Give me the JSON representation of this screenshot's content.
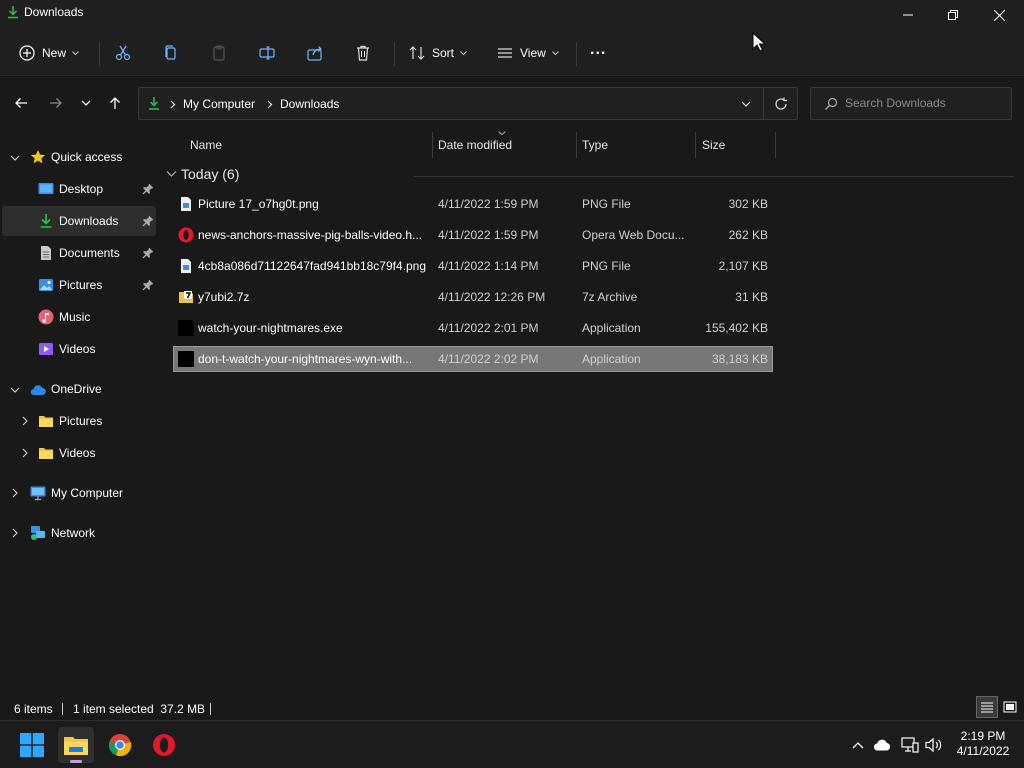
{
  "window": {
    "title": "Downloads"
  },
  "toolbar": {
    "new_label": "New",
    "sort_label": "Sort",
    "view_label": "View",
    "more_label": "..."
  },
  "address": {
    "root": "My Computer",
    "current": "Downloads"
  },
  "search": {
    "placeholder": "Search Downloads"
  },
  "sidebar": {
    "quick_access": "Quick access",
    "items": [
      {
        "label": "Desktop"
      },
      {
        "label": "Downloads"
      },
      {
        "label": "Documents"
      },
      {
        "label": "Pictures"
      },
      {
        "label": "Music"
      },
      {
        "label": "Videos"
      }
    ],
    "onedrive": "OneDrive",
    "onedrive_items": [
      {
        "label": "Pictures"
      },
      {
        "label": "Videos"
      }
    ],
    "my_computer": "My Computer",
    "network": "Network"
  },
  "columns": {
    "name": "Name",
    "date": "Date modified",
    "type": "Type",
    "size": "Size"
  },
  "group": {
    "label": "Today (6)"
  },
  "files": [
    {
      "name": "Picture 17_o7hg0t.png",
      "date": "4/11/2022 1:59 PM",
      "type": "PNG File",
      "size": "302 KB",
      "icon": "image-file-icon"
    },
    {
      "name": "news-anchors-massive-pig-balls-video.h...",
      "date": "4/11/2022 1:59 PM",
      "type": "Opera Web Docu...",
      "size": "262 KB",
      "icon": "opera-icon"
    },
    {
      "name": "4cb8a086d71122647fad941bb18c79f4.png",
      "date": "4/11/2022 1:14 PM",
      "type": "PNG File",
      "size": "2,107 KB",
      "icon": "image-file-icon"
    },
    {
      "name": "y7ubi2.7z",
      "date": "4/11/2022 12:26 PM",
      "type": "7z Archive",
      "size": "31 KB",
      "icon": "archive-icon"
    },
    {
      "name": "watch-your-nightmares.exe",
      "date": "4/11/2022 2:01 PM",
      "type": "Application",
      "size": "155,402 KB",
      "icon": "application-icon"
    },
    {
      "name": "don-t-watch-your-nightmares-wyn-with...",
      "date": "4/11/2022 2:02 PM",
      "type": "Application",
      "size": "38,183 KB",
      "icon": "application-icon"
    }
  ],
  "status": {
    "items": "6 items",
    "selected": "1 item selected  37.2 MB"
  },
  "clock": {
    "time": "2:19 PM",
    "date": "4/11/2022"
  },
  "colors": {
    "accent": "#4cc2ff",
    "folder": "#f2c744",
    "selection": "#777777"
  }
}
